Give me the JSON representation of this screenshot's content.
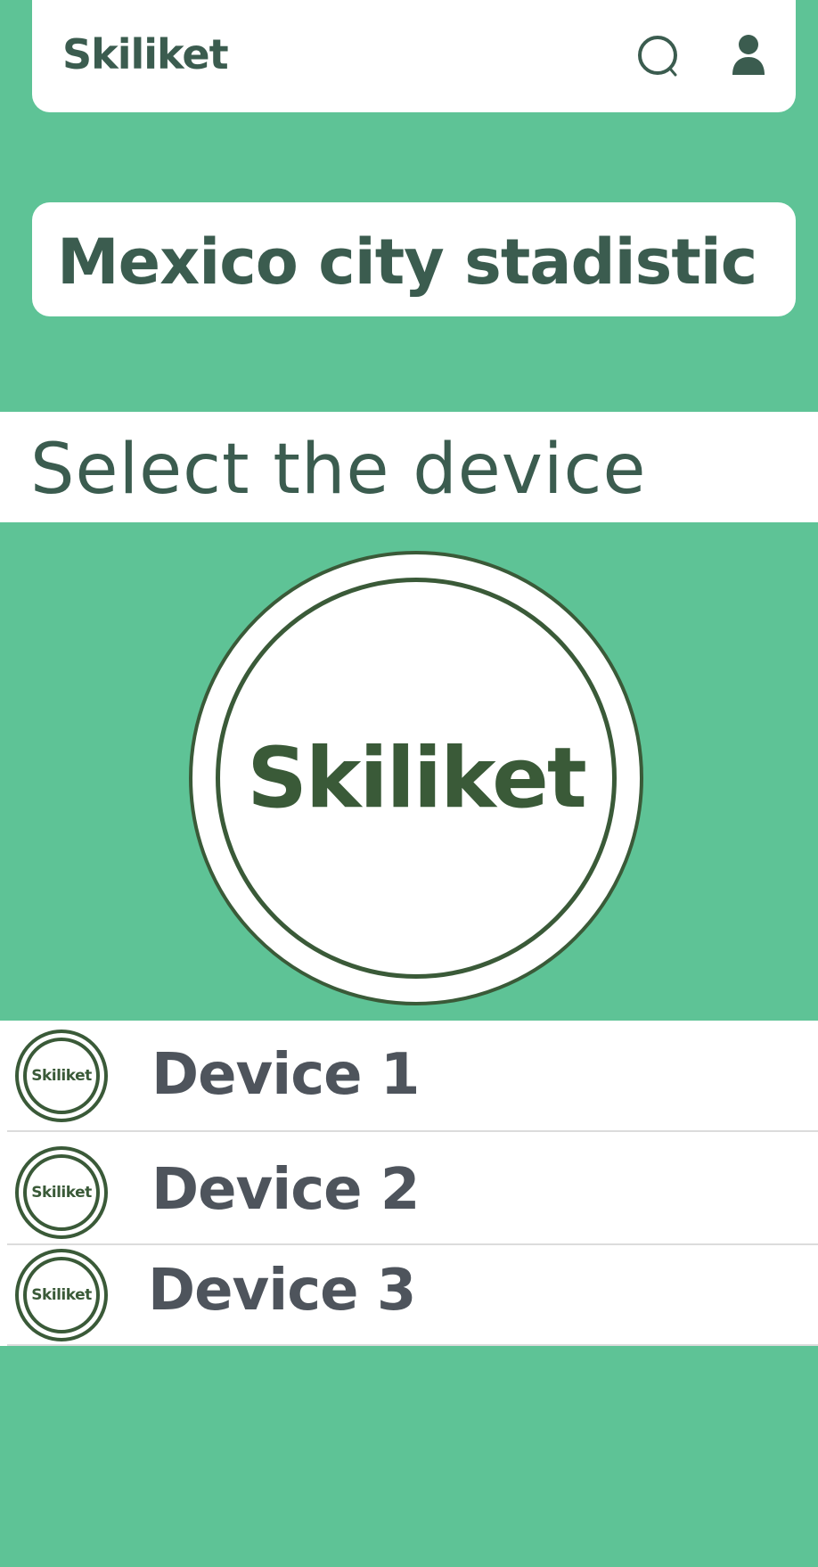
{
  "header": {
    "app_title": "Skiliket",
    "search_icon": "search-icon",
    "profile_icon": "user-icon"
  },
  "stat_card": {
    "title": "Mexico city stadistic"
  },
  "section": {
    "title": "Select the device"
  },
  "logo": {
    "text": "Skiliket"
  },
  "devices": [
    {
      "label": "Device 1",
      "logo_text": "Skiliket"
    },
    {
      "label": "Device 2",
      "logo_text": "Skiliket"
    },
    {
      "label": "Device 3",
      "logo_text": "Skiliket"
    }
  ],
  "colors": {
    "background": "#5ec396",
    "primary_text": "#3b5c4f",
    "logo_green": "#3a5a38",
    "device_text": "#4e545c",
    "card": "#ffffff"
  }
}
